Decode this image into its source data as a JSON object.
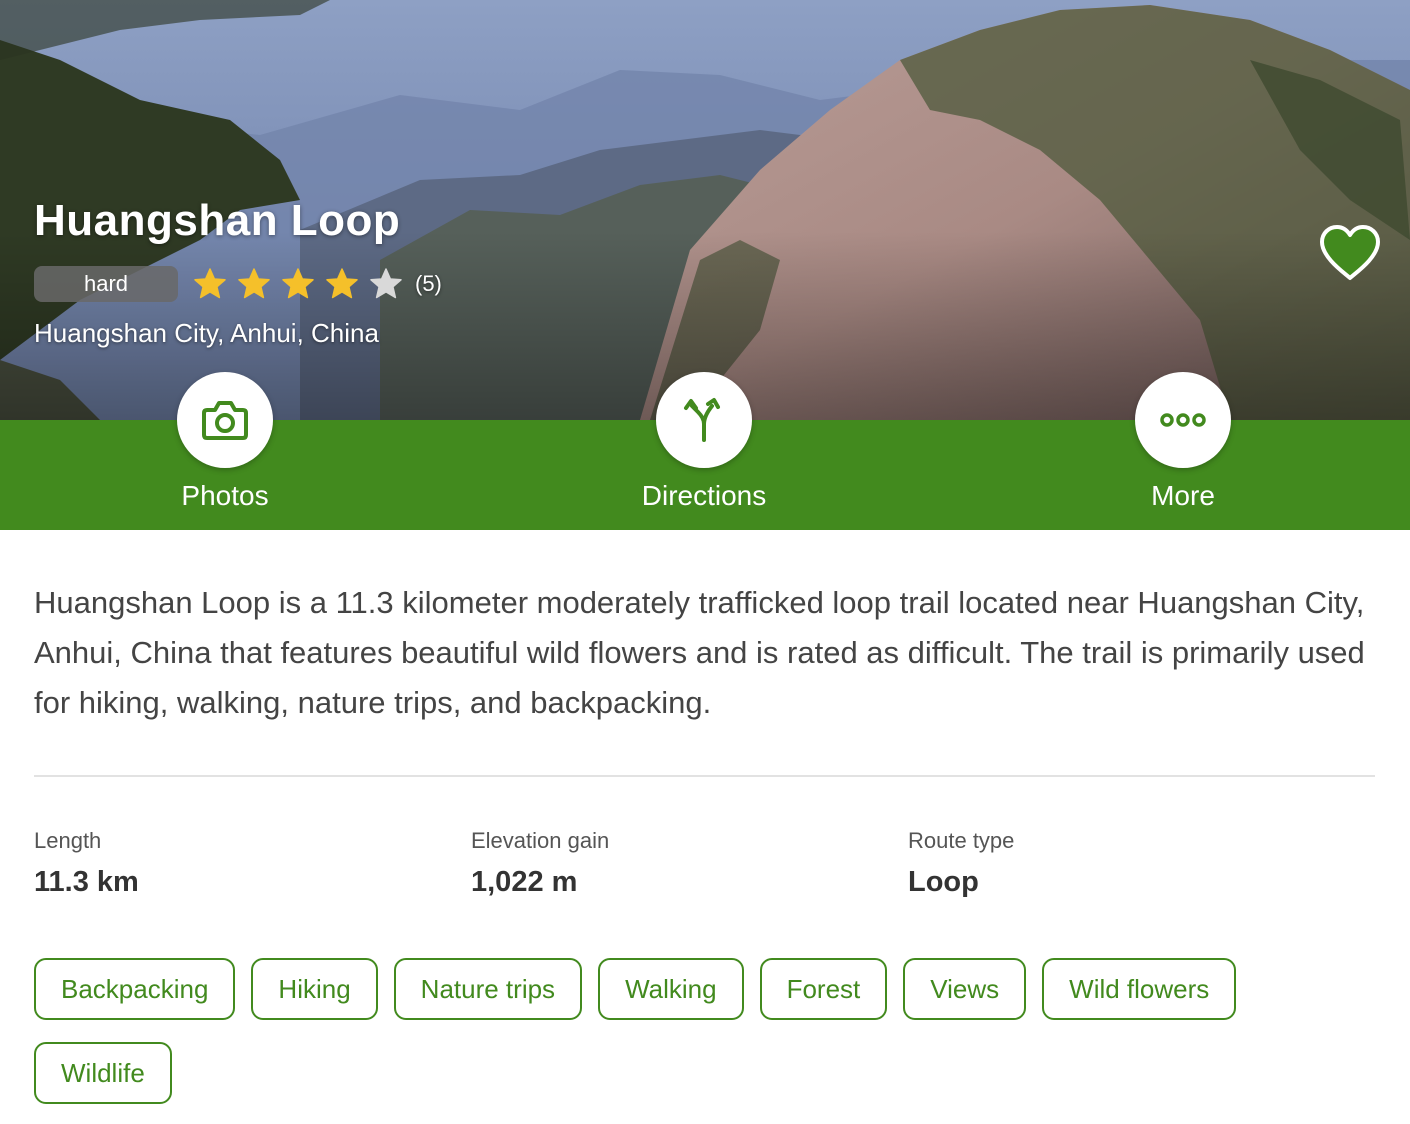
{
  "trail": {
    "name": "Huangshan Loop",
    "difficulty": "hard",
    "rating": 4,
    "rating_max": 5,
    "review_count": "(5)",
    "location": "Huangshan City, Anhui, China"
  },
  "actions": {
    "photos": {
      "label": "Photos",
      "icon": "camera-icon"
    },
    "directions": {
      "label": "Directions",
      "icon": "directions-icon"
    },
    "more": {
      "label": "More",
      "icon": "more-icon"
    }
  },
  "description": "Huangshan Loop is a 11.3 kilometer moderately trafficked loop trail located near Huangshan City, Anhui, China that features beautiful wild flowers and is rated as difficult. The trail is primarily used for hiking, walking, nature trips, and backpacking.",
  "stats": {
    "length": {
      "label": "Length",
      "value": "11.3 km"
    },
    "elevation": {
      "label": "Elevation gain",
      "value": "1,022 m"
    },
    "route": {
      "label": "Route type",
      "value": "Loop"
    }
  },
  "tags": [
    "Backpacking",
    "Hiking",
    "Nature trips",
    "Walking",
    "Forest",
    "Views",
    "Wild flowers",
    "Wildlife"
  ],
  "colors": {
    "brand_green": "#428a1e",
    "star_filled": "#f5c02a",
    "star_empty": "#d9d9d9",
    "heart_fill": "#428a1e"
  }
}
